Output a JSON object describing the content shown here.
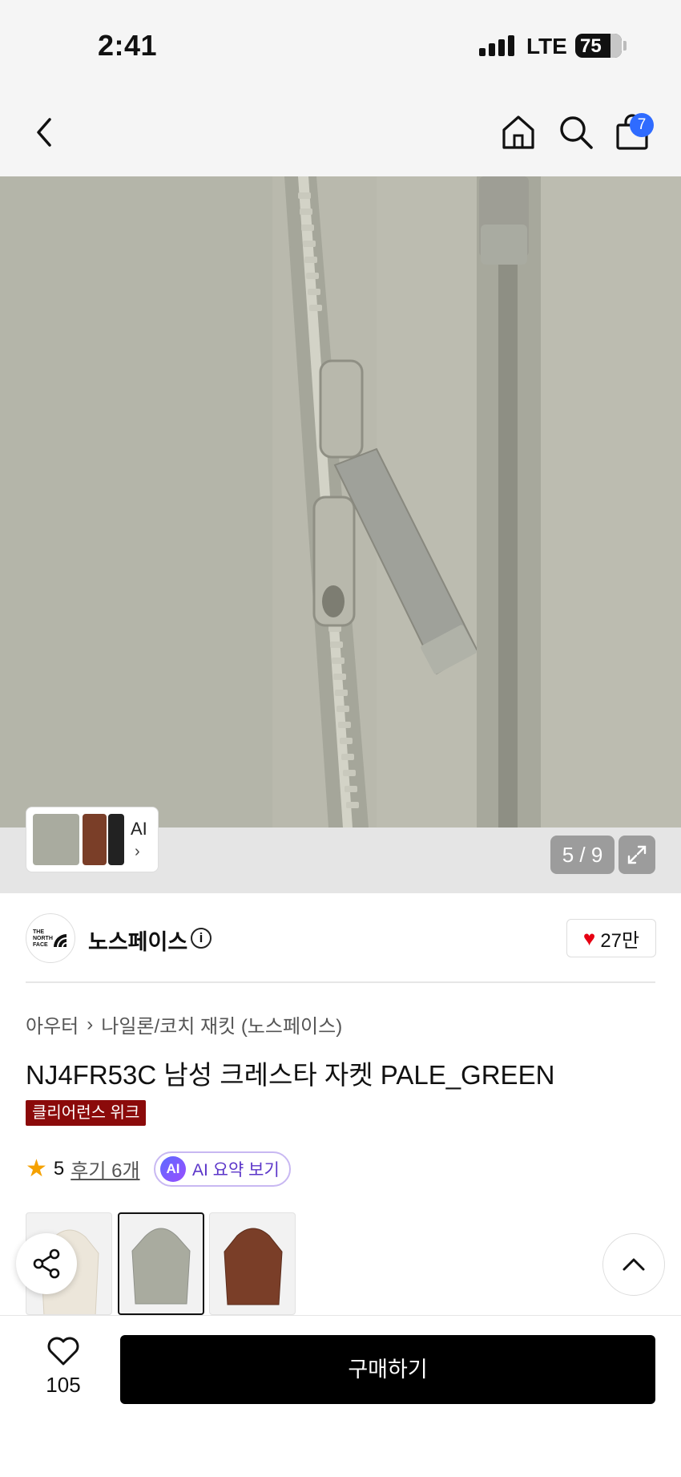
{
  "status_bar": {
    "time": "2:41",
    "network": "LTE",
    "battery": "75"
  },
  "nav": {
    "cart_count": "7",
    "icons": [
      "back-chevron-icon",
      "home-icon",
      "search-icon",
      "shopping-bag-icon"
    ]
  },
  "gallery": {
    "ai_label": "AI",
    "counter": "5 / 9",
    "colors": {
      "fabric": "#b9b9ad",
      "zipper": "#9e9e92"
    }
  },
  "brand": {
    "name": "노스페이스",
    "likes": "27만",
    "logo_text": "THE NORTH FACE"
  },
  "product": {
    "breadcrumb": [
      "아우터",
      "나일론/코치 재킷 (노스페이스)"
    ],
    "title": "NJ4FR53C 남성 크레스타 자켓 PALE_GREEN",
    "badge": "클리어런스 위크",
    "rating": "5",
    "reviews": "후기 6개",
    "ai_summary": "AI 요약 보기"
  },
  "color_options": [
    {
      "name": "ivory",
      "color": "#ece6da",
      "selected": false
    },
    {
      "name": "pale-green",
      "color": "#a9ab9f",
      "selected": true
    },
    {
      "name": "brown",
      "color": "#7a3e28",
      "selected": false
    }
  ],
  "bottom_bar": {
    "wish_count": "105",
    "buy_label": "구매하기"
  },
  "accent_colors": {
    "badge": "#8b0a0a",
    "cart_badge": "#2f6bff",
    "heart": "#e60012",
    "star": "#f5a100"
  }
}
